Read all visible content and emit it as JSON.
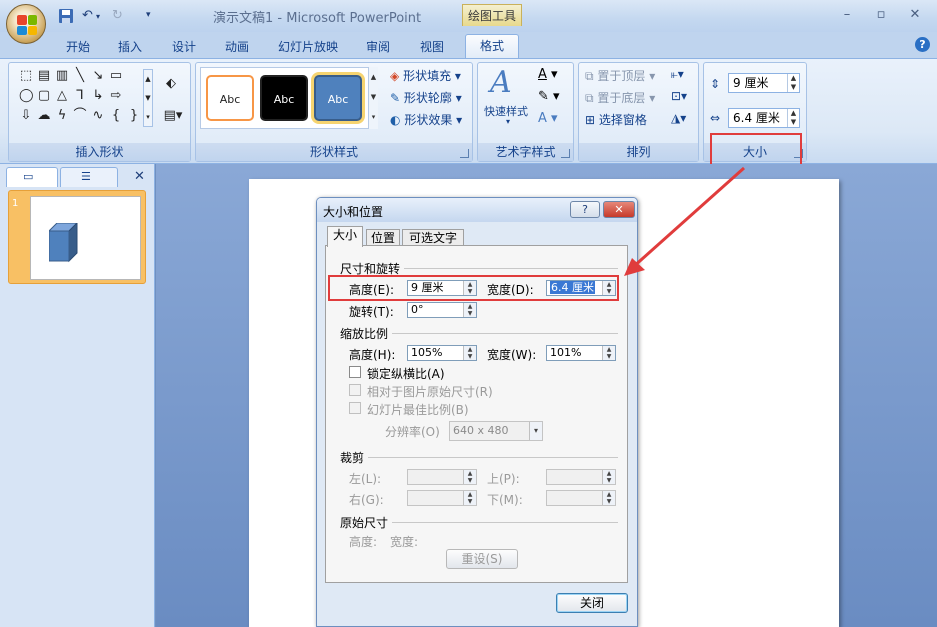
{
  "app": {
    "title": "演示文稿1 - Microsoft PowerPoint",
    "context_tab": "绘图工具"
  },
  "colors": {
    "highlight_red": "#e03c3c",
    "ribbon_bg": "#dce8f6",
    "accent_blue": "#4f81bd",
    "thumb_border": "#f8c064"
  },
  "tabs": [
    "开始",
    "插入",
    "设计",
    "动画",
    "幻灯片放映",
    "审阅",
    "视图",
    "格式"
  ],
  "ribbon": {
    "insert_shapes_label": "插入形状",
    "shape_styles": {
      "label": "形状样式",
      "sample": "Abc",
      "fill": "形状填充",
      "outline": "形状轮廓",
      "effects": "形状效果"
    },
    "wordart": {
      "label": "艺术字样式",
      "quick": "快速样式"
    },
    "arrange": {
      "label": "排列",
      "front": "置于顶层",
      "back": "置于底层",
      "pane": "选择窗格"
    },
    "size": {
      "label": "大小",
      "height": "9 厘米",
      "width": "6.4 厘米"
    }
  },
  "dialog": {
    "title": "大小和位置",
    "help": "?",
    "close": "✕",
    "tabs": [
      "大小",
      "位置",
      "可选文字"
    ],
    "size_rotate": {
      "section": "尺寸和旋转",
      "height_label": "高度(E):",
      "height_value": "9 厘米",
      "width_label": "宽度(D):",
      "width_value": "6.4 厘米",
      "rotation_label": "旋转(T):",
      "rotation_value": "0°"
    },
    "scale": {
      "section": "缩放比例",
      "height_label": "高度(H):",
      "height_value": "105%",
      "width_label": "宽度(W):",
      "width_value": "101%",
      "lock_ratio": "锁定纵横比(A)",
      "relative": "相对于图片原始尺寸(R)",
      "best_scale": "幻灯片最佳比例(B)",
      "resolution_label": "分辨率(O)",
      "resolution_value": "640 x 480"
    },
    "crop": {
      "section": "裁剪",
      "left": "左(L):",
      "top": "上(P):",
      "right": "右(G):",
      "bottom": "下(M):"
    },
    "original": {
      "section": "原始尺寸",
      "height": "高度:",
      "width": "宽度:",
      "reset": "重设(S)"
    },
    "close_button": "关闭"
  },
  "slides": {
    "number": "1"
  }
}
